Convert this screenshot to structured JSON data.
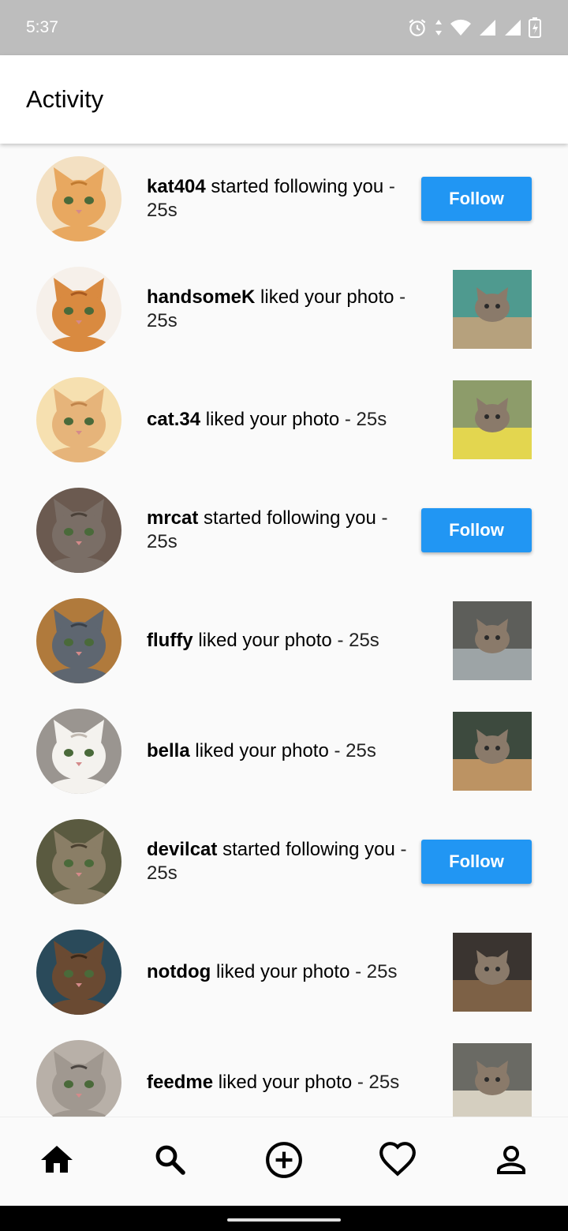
{
  "status_bar": {
    "time": "5:37",
    "icons": [
      "alarm-icon",
      "data-arrows-icon",
      "wifi-icon",
      "signal-icon",
      "signal-icon",
      "battery-charging-icon"
    ]
  },
  "app_bar": {
    "title": "Activity"
  },
  "activity": [
    {
      "username": "kat404",
      "action": "started following you",
      "time": "25s",
      "trailing": "follow",
      "button_label": "Follow",
      "avatar": "avatar-orange-kitten",
      "avatar_bg": "#f3e0c2"
    },
    {
      "username": "handsomeK",
      "action": "liked your photo",
      "time": "25s",
      "trailing": "photo",
      "avatar": "avatar-orange-cat",
      "avatar_bg": "#f6f0ea",
      "photo_colors": [
        "#4f9a8f",
        "#c8a27a"
      ]
    },
    {
      "username": "cat.34",
      "action": "liked your photo",
      "time": "25s",
      "trailing": "photo",
      "avatar": "avatar-ginger-kitten",
      "avatar_bg": "#f6e0b0",
      "photo_colors": [
        "#8d9c6a",
        "#f2e04a"
      ]
    },
    {
      "username": "mrcat",
      "action": "started following you",
      "time": "25s",
      "trailing": "follow",
      "button_label": "Follow",
      "avatar": "avatar-gray-kitten",
      "avatar_bg": "#6b5a50"
    },
    {
      "username": "fluffy",
      "action": "liked your photo",
      "time": "25s",
      "trailing": "photo",
      "avatar": "avatar-gray-cat",
      "avatar_bg": "#b07a3c",
      "photo_colors": [
        "#5d5e5a",
        "#a8b0b4"
      ]
    },
    {
      "username": "bella",
      "action": "liked your photo",
      "time": "25s",
      "trailing": "photo",
      "avatar": "avatar-white-kitten",
      "avatar_bg": "#9a9590",
      "photo_colors": [
        "#3d4a3e",
        "#d2a06a"
      ]
    },
    {
      "username": "devilcat",
      "action": "started following you",
      "time": "25s",
      "trailing": "follow",
      "button_label": "Follow",
      "avatar": "avatar-tabby-kitten",
      "avatar_bg": "#5a5a40"
    },
    {
      "username": "notdog",
      "action": "liked your photo",
      "time": "25s",
      "trailing": "photo",
      "avatar": "avatar-longhair-cat",
      "avatar_bg": "#2a4a5a",
      "photo_colors": [
        "#3a3430",
        "#8a6a4a"
      ]
    },
    {
      "username": "feedme",
      "action": "liked your photo",
      "time": "25s",
      "trailing": "photo",
      "avatar": "avatar-tabby-face",
      "avatar_bg": "#b8b0a8",
      "photo_colors": [
        "#6a6a64",
        "#e8e0d0"
      ]
    }
  ],
  "bottom_nav": [
    {
      "icon": "home-icon",
      "active": true
    },
    {
      "icon": "search-icon"
    },
    {
      "icon": "add-circle-icon"
    },
    {
      "icon": "heart-icon"
    },
    {
      "icon": "person-icon"
    }
  ],
  "colors": {
    "accent": "#2196f3",
    "background": "#fafafa",
    "status_bar": "#bdbdbd"
  }
}
